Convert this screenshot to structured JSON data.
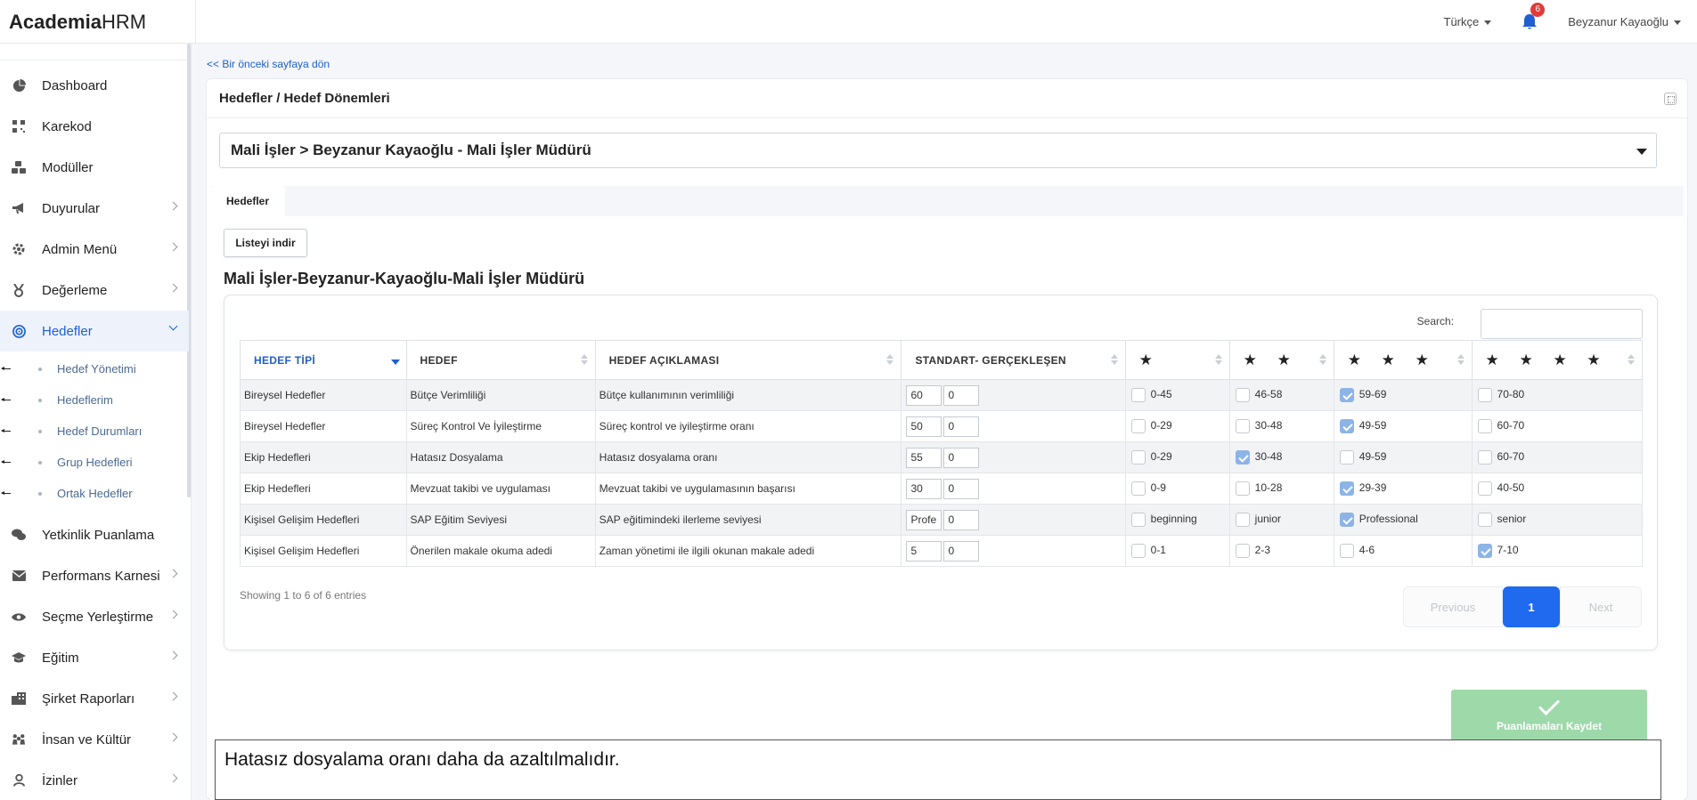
{
  "brand": {
    "bold": "Academia",
    "light": "HRM"
  },
  "topbar": {
    "language": "Türkçe",
    "notification_count": "6",
    "user_name": "Beyzanur Kayaoğlu"
  },
  "sidebar": {
    "items": [
      {
        "label": "Dashboard",
        "icon": "pie-chart-icon",
        "chevron": false
      },
      {
        "label": "Karekod",
        "icon": "qrcode-icon",
        "chevron": false
      },
      {
        "label": "Modüller",
        "icon": "cubes-icon",
        "chevron": false
      },
      {
        "label": "Duyurular",
        "icon": "megaphone-icon",
        "chevron": true
      },
      {
        "label": "Admin Menü",
        "icon": "gear-icon",
        "chevron": true
      },
      {
        "label": "Değerleme",
        "icon": "medal-icon",
        "chevron": true
      },
      {
        "label": "Hedefler",
        "icon": "target-icon",
        "chevron": true,
        "active": true
      },
      {
        "label": "Yetkinlik Puanlama",
        "icon": "comments-icon",
        "chevron": false
      },
      {
        "label": "Performans Karnesi",
        "icon": "envelope-icon",
        "chevron": true
      },
      {
        "label": "Seçme Yerleştirme",
        "icon": "eye-icon",
        "chevron": true
      },
      {
        "label": "Eğitim",
        "icon": "graduation-cap-icon",
        "chevron": true
      },
      {
        "label": "Şirket Raporları",
        "icon": "building-icon",
        "chevron": true
      },
      {
        "label": "İnsan ve Kültür",
        "icon": "people-icon",
        "chevron": true
      },
      {
        "label": "İzinler",
        "icon": "user-icon",
        "chevron": true
      }
    ],
    "subitems": [
      "Hedef Yönetimi",
      "Hedeflerim",
      "Hedef Durumları",
      "Grup Hedefleri",
      "Ortak Hedefler"
    ]
  },
  "main": {
    "back_link": "<< Bir önceki sayfaya dön",
    "card_title": "Hedefler / Hedef Dönemleri",
    "selected_period": "Mali İşler > Beyzanur Kayaoğlu - Mali İşler Müdürü",
    "tab_label": "Hedefler",
    "download_button": "Listeyi indir",
    "list_title": "Mali İşler-Beyzanur-Kayaoğlu-Mali İşler Müdürü",
    "search_label": "Search:",
    "search_value": "",
    "entries_info": "Showing 1 to 6 of 6 entries",
    "pagination": {
      "previous": "Previous",
      "current": "1",
      "next": "Next"
    },
    "save_button": "Puanlamaları Kaydet",
    "comment_text": "Hatasız dosyalama oranı daha da azaltılmalıdır."
  },
  "table": {
    "headers": [
      "HEDEF TİPİ",
      "HEDEF",
      "HEDEF AÇIKLAMASI",
      "STANDART- GERÇEKLEŞEN",
      "★",
      "★ ★",
      "★ ★ ★",
      "★ ★ ★ ★"
    ],
    "rows": [
      {
        "type": "Bireysel Hedefler",
        "goal": "Bütçe Verimliliği",
        "desc": "Bütçe kullanımının verimliliği",
        "standard": "60",
        "actual": "0",
        "r1": "0-45",
        "r2": "46-58",
        "r3": "59-69",
        "r4": "70-80",
        "checked": 3
      },
      {
        "type": "Bireysel Hedefler",
        "goal": "Süreç Kontrol Ve İyileştirme",
        "desc": "Süreç kontrol ve iyileştirme oranı",
        "standard": "50",
        "actual": "0",
        "r1": "0-29",
        "r2": "30-48",
        "r3": "49-59",
        "r4": "60-70",
        "checked": 3
      },
      {
        "type": "Ekip Hedefleri",
        "goal": "Hatasız Dosyalama",
        "desc": "Hatasız dosyalama oranı",
        "standard": "55",
        "actual": "0",
        "r1": "0-29",
        "r2": "30-48",
        "r3": "49-59",
        "r4": "60-70",
        "checked": 2
      },
      {
        "type": "Ekip Hedefleri",
        "goal": "Mevzuat takibi ve uygulaması",
        "desc": "Mevzuat takibi ve uygulamasının başarısı",
        "standard": "30",
        "actual": "0",
        "r1": "0-9",
        "r2": "10-28",
        "r3": "29-39",
        "r4": "40-50",
        "checked": 3
      },
      {
        "type": "Kişisel Gelişim Hedefleri",
        "goal": "SAP Eğitim Seviyesi",
        "desc": "SAP eğitimindeki ilerleme seviyesi",
        "standard": "Profe",
        "actual": "0",
        "r1": "beginning",
        "r2": "junior",
        "r3": "Professional",
        "r4": "senior",
        "checked": 3
      },
      {
        "type": "Kişisel Gelişim Hedefleri",
        "goal": "Önerilen makale okuma adedi",
        "desc": "Zaman yönetimi ile ilgili okunan makale adedi",
        "standard": "5",
        "actual": "0",
        "r1": "0-1",
        "r2": "2-3",
        "r3": "4-6",
        "r4": "7-10",
        "checked": 4
      }
    ]
  },
  "colors": {
    "accent": "#1f5fd1",
    "save_button": "#9ed9a9",
    "checked_box": "#8db4e6",
    "badge": "#e03b3b"
  }
}
